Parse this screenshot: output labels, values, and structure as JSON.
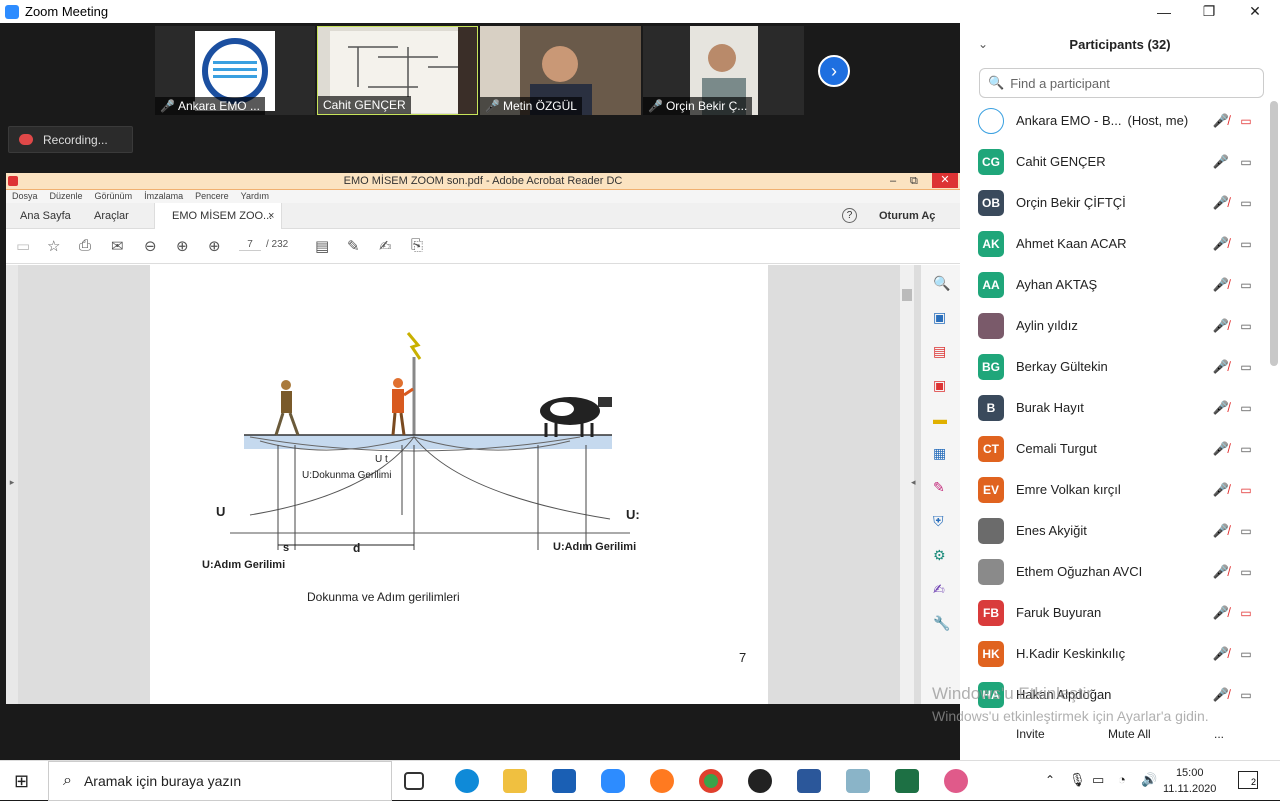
{
  "window": {
    "title": "Zoom Meeting"
  },
  "video": {
    "tiles": [
      {
        "name": "Ankara EMO ...",
        "muted": true
      },
      {
        "name": "Cahit GENÇER",
        "muted": false
      },
      {
        "name": "Metin ÖZGÜL",
        "muted": true
      },
      {
        "name": "Orçin Bekir Ç...",
        "muted": true
      }
    ],
    "recording": "Recording..."
  },
  "acrobat": {
    "title": "EMO MİSEM ZOOM son.pdf - Adobe Acrobat Reader DC",
    "menu": [
      "Dosya",
      "Düzenle",
      "Görünüm",
      "İmzalama",
      "Pencere",
      "Yardım"
    ],
    "tabs": {
      "home": "Ana Sayfa",
      "tools": "Araçlar",
      "doc": "EMO MİSEM ZOO...",
      "signin": "Oturum Aç"
    },
    "page_current": "7",
    "page_total": "/ 232",
    "figure": {
      "touch_label": "U:Dokunma Gerilimi",
      "step_label": "U:Adım Gerilimi",
      "u_left": "U",
      "u_right": "U:",
      "u_t": "U t",
      "s": "s",
      "d": "d",
      "caption": "Dokunma ve Adım gerilimleri",
      "page_number": "7"
    }
  },
  "participants": {
    "title": "Participants (32)",
    "search_placeholder": "Find a participant",
    "list": [
      {
        "initials": "",
        "name": "Ankara EMO - B...",
        "tag": "(Host, me)",
        "color": "#ffffff",
        "cam_off": true
      },
      {
        "initials": "CG",
        "name": "Cahit GENÇER",
        "tag": "",
        "color": "#1fa67a",
        "cam_off": false
      },
      {
        "initials": "OB",
        "name": "Orçin Bekir ÇİFTÇİ",
        "tag": "",
        "color": "#3a4a5c",
        "cam_off": false
      },
      {
        "initials": "AK",
        "name": "Ahmet Kaan ACAR",
        "tag": "",
        "color": "#1fa67a",
        "cam_off": false
      },
      {
        "initials": "AA",
        "name": "Ayhan AKTAŞ",
        "tag": "",
        "color": "#1fa67a",
        "cam_off": false
      },
      {
        "initials": "",
        "name": "Aylin yıldız",
        "tag": "",
        "color": "#7a5a6a",
        "cam_off": false
      },
      {
        "initials": "BG",
        "name": "Berkay Gültekin",
        "tag": "",
        "color": "#1fa67a",
        "cam_off": false
      },
      {
        "initials": "B",
        "name": "Burak Hayıt",
        "tag": "",
        "color": "#3a4a5c",
        "cam_off": false
      },
      {
        "initials": "CT",
        "name": "Cemali Turgut",
        "tag": "",
        "color": "#e0631f",
        "cam_off": false
      },
      {
        "initials": "EV",
        "name": "Emre Volkan kırçıl",
        "tag": "",
        "color": "#e0631f",
        "cam_off": true
      },
      {
        "initials": "",
        "name": "Enes Akyiğit",
        "tag": "",
        "color": "#6b6b6b",
        "cam_off": false
      },
      {
        "initials": "",
        "name": "Ethem Oğuzhan AVCI",
        "tag": "",
        "color": "#8a8a8a",
        "cam_off": false
      },
      {
        "initials": "FB",
        "name": "Faruk Buyuran",
        "tag": "",
        "color": "#d93b3b",
        "cam_off": true
      },
      {
        "initials": "HK",
        "name": "H.Kadir Keskinkılıç",
        "tag": "",
        "color": "#e0631f",
        "cam_off": false
      },
      {
        "initials": "HA",
        "name": "Hakan Alpdoğan",
        "tag": "",
        "color": "#1fa67a",
        "cam_off": false
      }
    ],
    "footer": {
      "invite": "Invite",
      "mute_all": "Mute All",
      "more": "..."
    }
  },
  "watermark": {
    "line1": "Windows'u Etkinleştir",
    "line2": "Windows'u etkinleştirmek için Ayarlar'a gidin."
  },
  "taskbar": {
    "search_placeholder": "Aramak için buraya yazın",
    "time": "15:00",
    "date": "11.11.2020",
    "notifications": "2"
  }
}
